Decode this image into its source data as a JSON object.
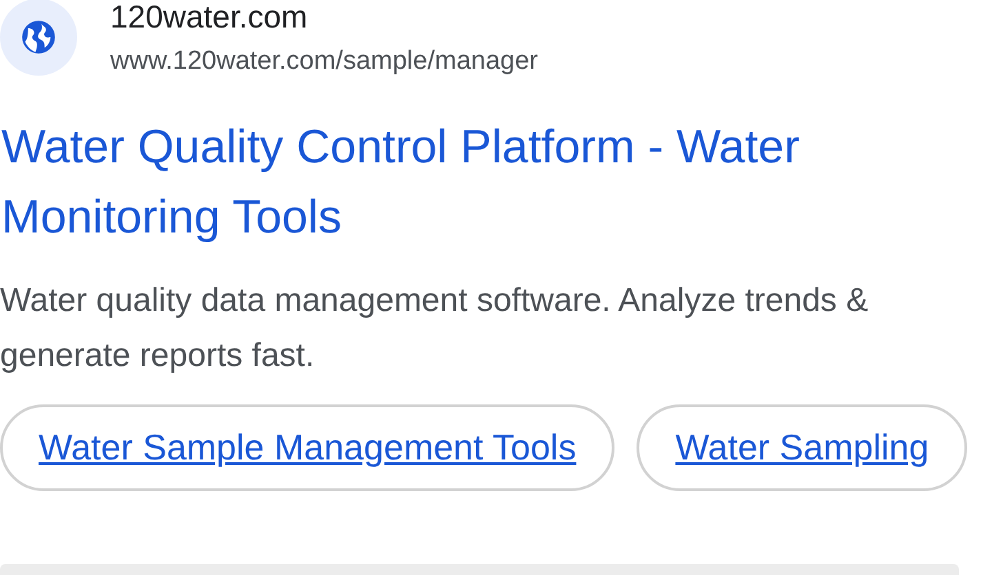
{
  "site": {
    "name": "120water.com",
    "url": "www.120water.com/sample/manager"
  },
  "title": "Water Quality Control Platform - Water Monitoring Tools",
  "description": "Water quality data management software. Analyze trends & generate reports fast.",
  "chips": [
    {
      "label": "Water Sample Management Tools"
    },
    {
      "label": "Water Sampling"
    }
  ]
}
